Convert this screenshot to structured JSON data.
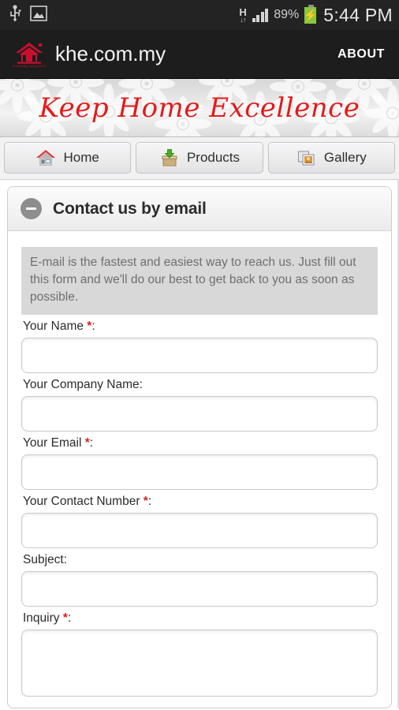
{
  "status_bar": {
    "usb_icon": "usb-icon",
    "image_icon": "picture-icon",
    "network_type": "H",
    "network_arrows": "↓↑",
    "battery_percent": "89%",
    "charging_icon": "⚡",
    "clock": "5:44 PM"
  },
  "action_bar": {
    "logo_icon": "khe-house-logo-icon",
    "title": "khe.com.my",
    "about_label": "ABOUT"
  },
  "banner": {
    "tagline": "Keep Home Excellence",
    "background_pattern": "daisy-flowers",
    "text_color": "#e11b1b"
  },
  "tabs": [
    {
      "id": "home",
      "label": "Home",
      "icon": "house-icon"
    },
    {
      "id": "products",
      "label": "Products",
      "icon": "package-download-icon"
    },
    {
      "id": "gallery",
      "label": "Gallery",
      "icon": "photo-stack-icon"
    }
  ],
  "card": {
    "collapse_icon": "minus-circle-icon",
    "title": "Contact us by email",
    "intro": "E-mail is the fastest and easiest way to reach us. Just fill out this form and we'll do our best to get back to you as soon as possible."
  },
  "form": {
    "fields": [
      {
        "id": "name",
        "label": "Your Name",
        "required": true,
        "suffix": ":",
        "value": "",
        "placeholder": "",
        "type": "text"
      },
      {
        "id": "company",
        "label": "Your Company Name",
        "required": false,
        "suffix": ":",
        "value": "",
        "placeholder": "",
        "type": "text"
      },
      {
        "id": "email",
        "label": "Your Email",
        "required": true,
        "suffix": ":",
        "value": "",
        "placeholder": "",
        "type": "text"
      },
      {
        "id": "contact",
        "label": "Your Contact Number",
        "required": true,
        "suffix": ":",
        "value": "",
        "placeholder": "",
        "type": "text"
      },
      {
        "id": "subject",
        "label": "Subject",
        "required": false,
        "suffix": ":",
        "value": "",
        "placeholder": "",
        "type": "text"
      },
      {
        "id": "inquiry",
        "label": "Inquiry",
        "required": true,
        "suffix": ":",
        "value": "",
        "placeholder": "",
        "type": "textarea"
      }
    ],
    "required_marker": "*"
  },
  "colors": {
    "brand_red": "#e11b1b",
    "status_bar_bg": "#232323",
    "action_bar_bg": "#1d1d1d",
    "battery_green": "#8cc63f"
  }
}
